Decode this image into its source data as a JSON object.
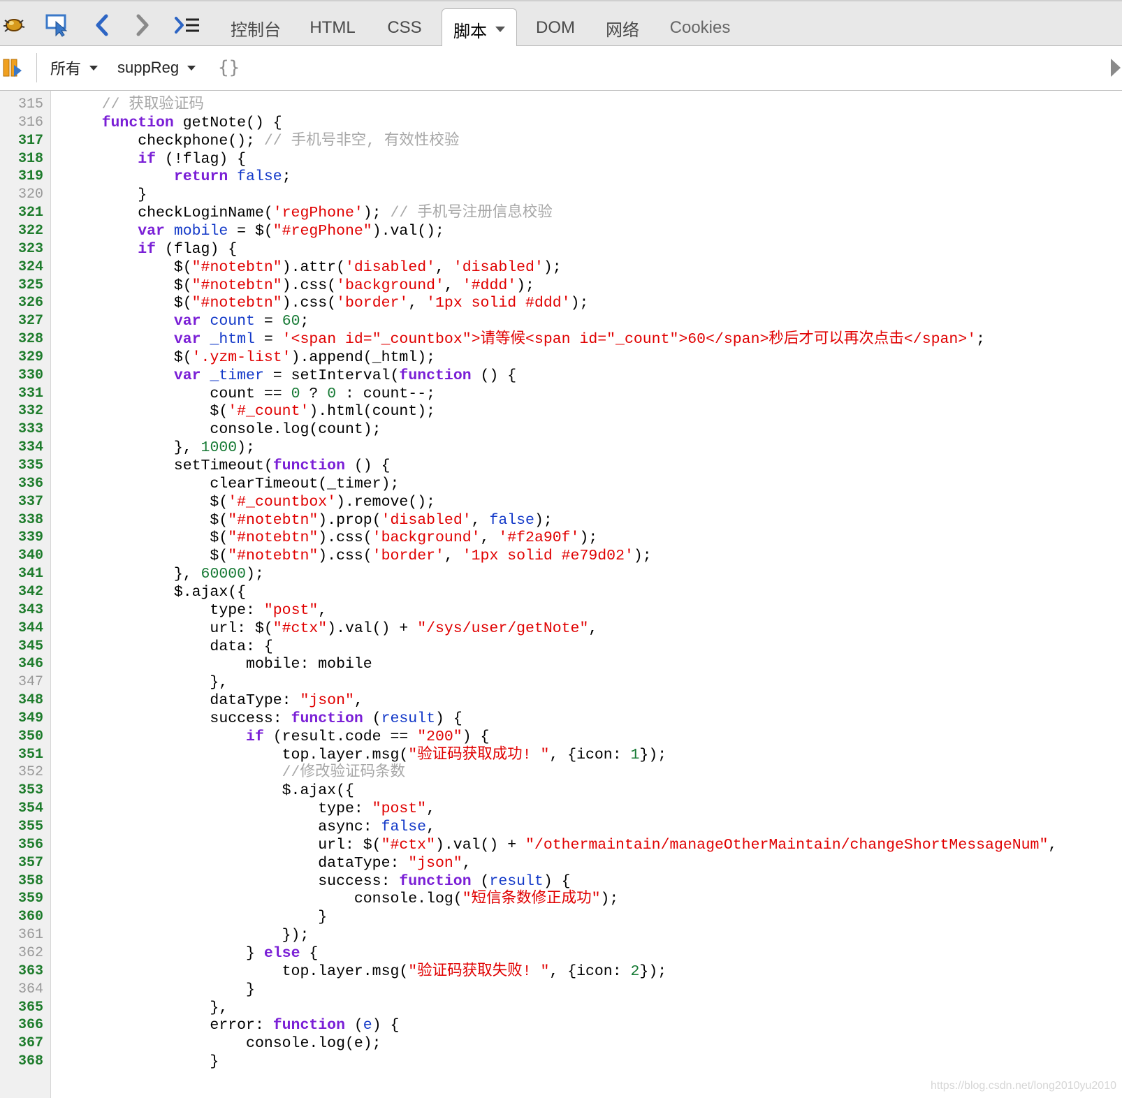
{
  "toolbar": {
    "tabs": [
      {
        "label": "控制台"
      },
      {
        "label": "HTML"
      },
      {
        "label": "CSS"
      },
      {
        "label": "脚本"
      },
      {
        "label": "DOM"
      },
      {
        "label": "网络"
      },
      {
        "label": "Cookies"
      }
    ],
    "active_tab": "脚本"
  },
  "subbar": {
    "filter_label": "所有",
    "script_name": "suppReg",
    "pretty_print_label": "{}"
  },
  "code_lines": [
    {
      "num": "315",
      "exec": false,
      "tokens": [
        {
          "t": "c",
          "v": "    // 获取验证码"
        }
      ]
    },
    {
      "num": "316",
      "exec": false,
      "tokens": [
        {
          "t": "p",
          "v": "    "
        },
        {
          "t": "k",
          "v": "function"
        },
        {
          "t": "p",
          "v": " getNote() {"
        }
      ]
    },
    {
      "num": "317",
      "exec": true,
      "tokens": [
        {
          "t": "p",
          "v": "        checkphone(); "
        },
        {
          "t": "c",
          "v": "// 手机号非空, 有效性校验"
        }
      ]
    },
    {
      "num": "318",
      "exec": true,
      "tokens": [
        {
          "t": "p",
          "v": "        "
        },
        {
          "t": "k",
          "v": "if"
        },
        {
          "t": "p",
          "v": " (!flag) {"
        }
      ]
    },
    {
      "num": "319",
      "exec": true,
      "tokens": [
        {
          "t": "p",
          "v": "            "
        },
        {
          "t": "k",
          "v": "return"
        },
        {
          "t": "p",
          "v": " "
        },
        {
          "t": "n",
          "v": "false"
        },
        {
          "t": "p",
          "v": ";"
        }
      ]
    },
    {
      "num": "320",
      "exec": false,
      "tokens": [
        {
          "t": "p",
          "v": "        }"
        }
      ]
    },
    {
      "num": "321",
      "exec": true,
      "tokens": [
        {
          "t": "p",
          "v": "        checkLoginName("
        },
        {
          "t": "s",
          "v": "'regPhone'"
        },
        {
          "t": "p",
          "v": "); "
        },
        {
          "t": "c",
          "v": "// 手机号注册信息校验"
        }
      ]
    },
    {
      "num": "322",
      "exec": true,
      "tokens": [
        {
          "t": "p",
          "v": "        "
        },
        {
          "t": "k",
          "v": "var"
        },
        {
          "t": "p",
          "v": " "
        },
        {
          "t": "n",
          "v": "mobile"
        },
        {
          "t": "p",
          "v": " = $("
        },
        {
          "t": "s",
          "v": "\"#regPhone\""
        },
        {
          "t": "p",
          "v": ").val();"
        }
      ]
    },
    {
      "num": "323",
      "exec": true,
      "tokens": [
        {
          "t": "p",
          "v": "        "
        },
        {
          "t": "k",
          "v": "if"
        },
        {
          "t": "p",
          "v": " (flag) {"
        }
      ]
    },
    {
      "num": "324",
      "exec": true,
      "tokens": [
        {
          "t": "p",
          "v": "            $("
        },
        {
          "t": "s",
          "v": "\"#notebtn\""
        },
        {
          "t": "p",
          "v": ").attr("
        },
        {
          "t": "s",
          "v": "'disabled'"
        },
        {
          "t": "p",
          "v": ", "
        },
        {
          "t": "s",
          "v": "'disabled'"
        },
        {
          "t": "p",
          "v": ");"
        }
      ]
    },
    {
      "num": "325",
      "exec": true,
      "tokens": [
        {
          "t": "p",
          "v": "            $("
        },
        {
          "t": "s",
          "v": "\"#notebtn\""
        },
        {
          "t": "p",
          "v": ").css("
        },
        {
          "t": "s",
          "v": "'background'"
        },
        {
          "t": "p",
          "v": ", "
        },
        {
          "t": "s",
          "v": "'#ddd'"
        },
        {
          "t": "p",
          "v": ");"
        }
      ]
    },
    {
      "num": "326",
      "exec": true,
      "tokens": [
        {
          "t": "p",
          "v": "            $("
        },
        {
          "t": "s",
          "v": "\"#notebtn\""
        },
        {
          "t": "p",
          "v": ").css("
        },
        {
          "t": "s",
          "v": "'border'"
        },
        {
          "t": "p",
          "v": ", "
        },
        {
          "t": "s",
          "v": "'1px solid #ddd'"
        },
        {
          "t": "p",
          "v": ");"
        }
      ]
    },
    {
      "num": "327",
      "exec": true,
      "tokens": [
        {
          "t": "p",
          "v": "            "
        },
        {
          "t": "k",
          "v": "var"
        },
        {
          "t": "p",
          "v": " "
        },
        {
          "t": "n",
          "v": "count"
        },
        {
          "t": "p",
          "v": " = "
        },
        {
          "t": "num",
          "v": "60"
        },
        {
          "t": "p",
          "v": ";"
        }
      ]
    },
    {
      "num": "328",
      "exec": true,
      "tokens": [
        {
          "t": "p",
          "v": "            "
        },
        {
          "t": "k",
          "v": "var"
        },
        {
          "t": "p",
          "v": " "
        },
        {
          "t": "n",
          "v": "_html"
        },
        {
          "t": "p",
          "v": " = "
        },
        {
          "t": "s",
          "v": "'<span id=\"_countbox\">请等候<span id=\"_count\">60</span>秒后才可以再次点击</span>'"
        },
        {
          "t": "p",
          "v": ";"
        }
      ]
    },
    {
      "num": "329",
      "exec": true,
      "tokens": [
        {
          "t": "p",
          "v": "            $("
        },
        {
          "t": "s",
          "v": "'.yzm-list'"
        },
        {
          "t": "p",
          "v": ").append(_html);"
        }
      ]
    },
    {
      "num": "330",
      "exec": true,
      "tokens": [
        {
          "t": "p",
          "v": "            "
        },
        {
          "t": "k",
          "v": "var"
        },
        {
          "t": "p",
          "v": " "
        },
        {
          "t": "n",
          "v": "_timer"
        },
        {
          "t": "p",
          "v": " = setInterval("
        },
        {
          "t": "k",
          "v": "function"
        },
        {
          "t": "p",
          "v": " () {"
        }
      ]
    },
    {
      "num": "331",
      "exec": true,
      "tokens": [
        {
          "t": "p",
          "v": "                count == "
        },
        {
          "t": "num",
          "v": "0"
        },
        {
          "t": "p",
          "v": " ? "
        },
        {
          "t": "num",
          "v": "0"
        },
        {
          "t": "p",
          "v": " : count--;"
        }
      ]
    },
    {
      "num": "332",
      "exec": true,
      "tokens": [
        {
          "t": "p",
          "v": "                $("
        },
        {
          "t": "s",
          "v": "'#_count'"
        },
        {
          "t": "p",
          "v": ").html(count);"
        }
      ]
    },
    {
      "num": "333",
      "exec": true,
      "tokens": [
        {
          "t": "p",
          "v": "                console.log(count);"
        }
      ]
    },
    {
      "num": "334",
      "exec": true,
      "tokens": [
        {
          "t": "p",
          "v": "            }, "
        },
        {
          "t": "num",
          "v": "1000"
        },
        {
          "t": "p",
          "v": ");"
        }
      ]
    },
    {
      "num": "335",
      "exec": true,
      "tokens": [
        {
          "t": "p",
          "v": "            setTimeout("
        },
        {
          "t": "k",
          "v": "function"
        },
        {
          "t": "p",
          "v": " () {"
        }
      ]
    },
    {
      "num": "336",
      "exec": true,
      "tokens": [
        {
          "t": "p",
          "v": "                clearTimeout(_timer);"
        }
      ]
    },
    {
      "num": "337",
      "exec": true,
      "tokens": [
        {
          "t": "p",
          "v": "                $("
        },
        {
          "t": "s",
          "v": "'#_countbox'"
        },
        {
          "t": "p",
          "v": ").remove();"
        }
      ]
    },
    {
      "num": "338",
      "exec": true,
      "tokens": [
        {
          "t": "p",
          "v": "                $("
        },
        {
          "t": "s",
          "v": "\"#notebtn\""
        },
        {
          "t": "p",
          "v": ").prop("
        },
        {
          "t": "s",
          "v": "'disabled'"
        },
        {
          "t": "p",
          "v": ", "
        },
        {
          "t": "n",
          "v": "false"
        },
        {
          "t": "p",
          "v": ");"
        }
      ]
    },
    {
      "num": "339",
      "exec": true,
      "tokens": [
        {
          "t": "p",
          "v": "                $("
        },
        {
          "t": "s",
          "v": "\"#notebtn\""
        },
        {
          "t": "p",
          "v": ").css("
        },
        {
          "t": "s",
          "v": "'background'"
        },
        {
          "t": "p",
          "v": ", "
        },
        {
          "t": "s",
          "v": "'#f2a90f'"
        },
        {
          "t": "p",
          "v": ");"
        }
      ]
    },
    {
      "num": "340",
      "exec": true,
      "tokens": [
        {
          "t": "p",
          "v": "                $("
        },
        {
          "t": "s",
          "v": "\"#notebtn\""
        },
        {
          "t": "p",
          "v": ").css("
        },
        {
          "t": "s",
          "v": "'border'"
        },
        {
          "t": "p",
          "v": ", "
        },
        {
          "t": "s",
          "v": "'1px solid #e79d02'"
        },
        {
          "t": "p",
          "v": ");"
        }
      ]
    },
    {
      "num": "341",
      "exec": true,
      "tokens": [
        {
          "t": "p",
          "v": "            }, "
        },
        {
          "t": "num",
          "v": "60000"
        },
        {
          "t": "p",
          "v": ");"
        }
      ]
    },
    {
      "num": "342",
      "exec": true,
      "tokens": [
        {
          "t": "p",
          "v": "            $.ajax({"
        }
      ]
    },
    {
      "num": "343",
      "exec": true,
      "tokens": [
        {
          "t": "p",
          "v": "                type: "
        },
        {
          "t": "s",
          "v": "\"post\""
        },
        {
          "t": "p",
          "v": ","
        }
      ]
    },
    {
      "num": "344",
      "exec": true,
      "tokens": [
        {
          "t": "p",
          "v": "                url: $("
        },
        {
          "t": "s",
          "v": "\"#ctx\""
        },
        {
          "t": "p",
          "v": ").val() + "
        },
        {
          "t": "s",
          "v": "\"/sys/user/getNote\""
        },
        {
          "t": "p",
          "v": ","
        }
      ]
    },
    {
      "num": "345",
      "exec": true,
      "tokens": [
        {
          "t": "p",
          "v": "                data: {"
        }
      ]
    },
    {
      "num": "346",
      "exec": true,
      "tokens": [
        {
          "t": "p",
          "v": "                    mobile: mobile"
        }
      ]
    },
    {
      "num": "347",
      "exec": false,
      "tokens": [
        {
          "t": "p",
          "v": "                },"
        }
      ]
    },
    {
      "num": "348",
      "exec": true,
      "tokens": [
        {
          "t": "p",
          "v": "                dataType: "
        },
        {
          "t": "s",
          "v": "\"json\""
        },
        {
          "t": "p",
          "v": ","
        }
      ]
    },
    {
      "num": "349",
      "exec": true,
      "tokens": [
        {
          "t": "p",
          "v": "                success: "
        },
        {
          "t": "k",
          "v": "function"
        },
        {
          "t": "p",
          "v": " ("
        },
        {
          "t": "n",
          "v": "result"
        },
        {
          "t": "p",
          "v": ") {"
        }
      ]
    },
    {
      "num": "350",
      "exec": true,
      "tokens": [
        {
          "t": "p",
          "v": "                    "
        },
        {
          "t": "k",
          "v": "if"
        },
        {
          "t": "p",
          "v": " (result.code == "
        },
        {
          "t": "s",
          "v": "\"200\""
        },
        {
          "t": "p",
          "v": ") {"
        }
      ]
    },
    {
      "num": "351",
      "exec": true,
      "tokens": [
        {
          "t": "p",
          "v": "                        top.layer.msg("
        },
        {
          "t": "s",
          "v": "\"验证码获取成功! \""
        },
        {
          "t": "p",
          "v": ", {icon: "
        },
        {
          "t": "num",
          "v": "1"
        },
        {
          "t": "p",
          "v": "});"
        }
      ]
    },
    {
      "num": "352",
      "exec": false,
      "tokens": [
        {
          "t": "c",
          "v": "                        //修改验证码条数"
        }
      ]
    },
    {
      "num": "353",
      "exec": true,
      "tokens": [
        {
          "t": "p",
          "v": "                        $.ajax({"
        }
      ]
    },
    {
      "num": "354",
      "exec": true,
      "tokens": [
        {
          "t": "p",
          "v": "                            type: "
        },
        {
          "t": "s",
          "v": "\"post\""
        },
        {
          "t": "p",
          "v": ","
        }
      ]
    },
    {
      "num": "355",
      "exec": true,
      "tokens": [
        {
          "t": "p",
          "v": "                            async: "
        },
        {
          "t": "n",
          "v": "false"
        },
        {
          "t": "p",
          "v": ","
        }
      ]
    },
    {
      "num": "356",
      "exec": true,
      "tokens": [
        {
          "t": "p",
          "v": "                            url: $("
        },
        {
          "t": "s",
          "v": "\"#ctx\""
        },
        {
          "t": "p",
          "v": ").val() + "
        },
        {
          "t": "s",
          "v": "\"/othermaintain/manageOtherMaintain/changeShortMessageNum\""
        },
        {
          "t": "p",
          "v": ","
        }
      ]
    },
    {
      "num": "357",
      "exec": true,
      "tokens": [
        {
          "t": "p",
          "v": "                            dataType: "
        },
        {
          "t": "s",
          "v": "\"json\""
        },
        {
          "t": "p",
          "v": ","
        }
      ]
    },
    {
      "num": "358",
      "exec": true,
      "tokens": [
        {
          "t": "p",
          "v": "                            success: "
        },
        {
          "t": "k",
          "v": "function"
        },
        {
          "t": "p",
          "v": " ("
        },
        {
          "t": "n",
          "v": "result"
        },
        {
          "t": "p",
          "v": ") {"
        }
      ]
    },
    {
      "num": "359",
      "exec": true,
      "tokens": [
        {
          "t": "p",
          "v": "                                console.log("
        },
        {
          "t": "s",
          "v": "\"短信条数修正成功\""
        },
        {
          "t": "p",
          "v": ");"
        }
      ]
    },
    {
      "num": "360",
      "exec": true,
      "tokens": [
        {
          "t": "p",
          "v": "                            }"
        }
      ]
    },
    {
      "num": "361",
      "exec": false,
      "tokens": [
        {
          "t": "p",
          "v": "                        });"
        }
      ]
    },
    {
      "num": "362",
      "exec": false,
      "tokens": [
        {
          "t": "p",
          "v": "                    } "
        },
        {
          "t": "k",
          "v": "else"
        },
        {
          "t": "p",
          "v": " {"
        }
      ]
    },
    {
      "num": "363",
      "exec": true,
      "tokens": [
        {
          "t": "p",
          "v": "                        top.layer.msg("
        },
        {
          "t": "s",
          "v": "\"验证码获取失败! \""
        },
        {
          "t": "p",
          "v": ", {icon: "
        },
        {
          "t": "num",
          "v": "2"
        },
        {
          "t": "p",
          "v": "});"
        }
      ]
    },
    {
      "num": "364",
      "exec": false,
      "tokens": [
        {
          "t": "p",
          "v": "                    }"
        }
      ]
    },
    {
      "num": "365",
      "exec": true,
      "tokens": [
        {
          "t": "p",
          "v": "                },"
        }
      ]
    },
    {
      "num": "366",
      "exec": true,
      "tokens": [
        {
          "t": "p",
          "v": "                error: "
        },
        {
          "t": "k",
          "v": "function"
        },
        {
          "t": "p",
          "v": " ("
        },
        {
          "t": "n",
          "v": "e"
        },
        {
          "t": "p",
          "v": ") {"
        }
      ]
    },
    {
      "num": "367",
      "exec": true,
      "tokens": [
        {
          "t": "p",
          "v": "                    console.log(e);"
        }
      ]
    },
    {
      "num": "368",
      "exec": true,
      "tokens": [
        {
          "t": "p",
          "v": "                }"
        }
      ]
    }
  ],
  "watermark": "https://blog.csdn.net/long2010yu2010",
  "colors": {
    "keyword": "#7a1fd6",
    "identifier": "#1238c8",
    "string": "#e00000",
    "number": "#177a35",
    "comment": "#a7a7a7",
    "executable_line_number": "#1e7c2c"
  },
  "icons": [
    "firebug-icon",
    "inspect-icon",
    "back-icon",
    "forward-icon",
    "command-line-icon",
    "pause-icon",
    "expand-panel-icon"
  ]
}
